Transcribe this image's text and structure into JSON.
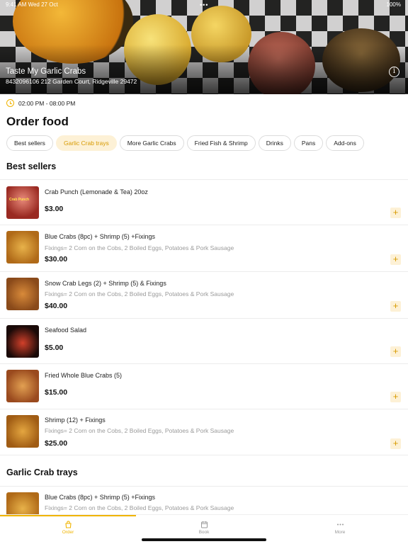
{
  "status_bar": {
    "time": "9:41 AM  Wed 27 Oct",
    "dots": "•••",
    "battery": "100%"
  },
  "restaurant": {
    "name": "Taste My Garlic Crabs",
    "address": "8432096106 212 Garden Court, Ridgeville 29472",
    "hours": "02:00 PM - 08:00 PM"
  },
  "page_title": "Order food",
  "categories": [
    {
      "label": "Best sellers",
      "active": false
    },
    {
      "label": "Garlic Crab trays",
      "active": true
    },
    {
      "label": "More Garlic Crabs",
      "active": false
    },
    {
      "label": "Fried Fish & Shrimp",
      "active": false
    },
    {
      "label": "Drinks",
      "active": false
    },
    {
      "label": "Pans",
      "active": false
    },
    {
      "label": "Add-ons",
      "active": false
    }
  ],
  "sections": [
    {
      "title": "Best sellers"
    },
    {
      "title": "Garlic Crab trays"
    }
  ],
  "items": [
    {
      "name": "Crab Punch (Lemonade & Tea) 20oz",
      "desc": "",
      "price": "$3.00",
      "thumb_label": "Crab Punch"
    },
    {
      "name": "Blue Crabs (8pc) + Shrimp (5) +Fixings",
      "desc": "Fixings= 2 Corn on the Cobs, 2 Boiled Eggs, Potatoes & Pork Sausage",
      "price": "$30.00"
    },
    {
      "name": "Snow Crab Legs (2) + Shrimp (5) & Fixings",
      "desc": "Fixings= 2 Corn on the Cobs, 2 Boiled Eggs, Potatoes & Pork Sausage",
      "price": "$40.00"
    },
    {
      "name": "Seafood Salad",
      "desc": "",
      "price": "$5.00"
    },
    {
      "name": "Fried Whole Blue Crabs (5)",
      "desc": "",
      "price": "$15.00"
    },
    {
      "name": "Shrimp (12) + Fixings",
      "desc": "Fixings= 2 Corn on the Cobs, 2 Boiled Eggs, Potatoes & Pork Sausage",
      "price": "$25.00"
    },
    {
      "name": "Blue Crabs (8pc) + Shrimp (5) +Fixings",
      "desc": "Fixings= 2 Corn on the Cobs, 2 Boiled Eggs, Potatoes & Pork Sausage",
      "price": ""
    }
  ],
  "add_symbol": "+",
  "tabs": [
    {
      "label": "Order",
      "icon": "bag-icon",
      "active": true
    },
    {
      "label": "Book",
      "icon": "calendar-icon",
      "active": false
    },
    {
      "label": "More",
      "icon": "more-icon",
      "active": false
    }
  ],
  "colors": {
    "accent": "#f0b400",
    "accent_bg": "#fdf1d6",
    "muted_text": "#9a9a9a"
  }
}
